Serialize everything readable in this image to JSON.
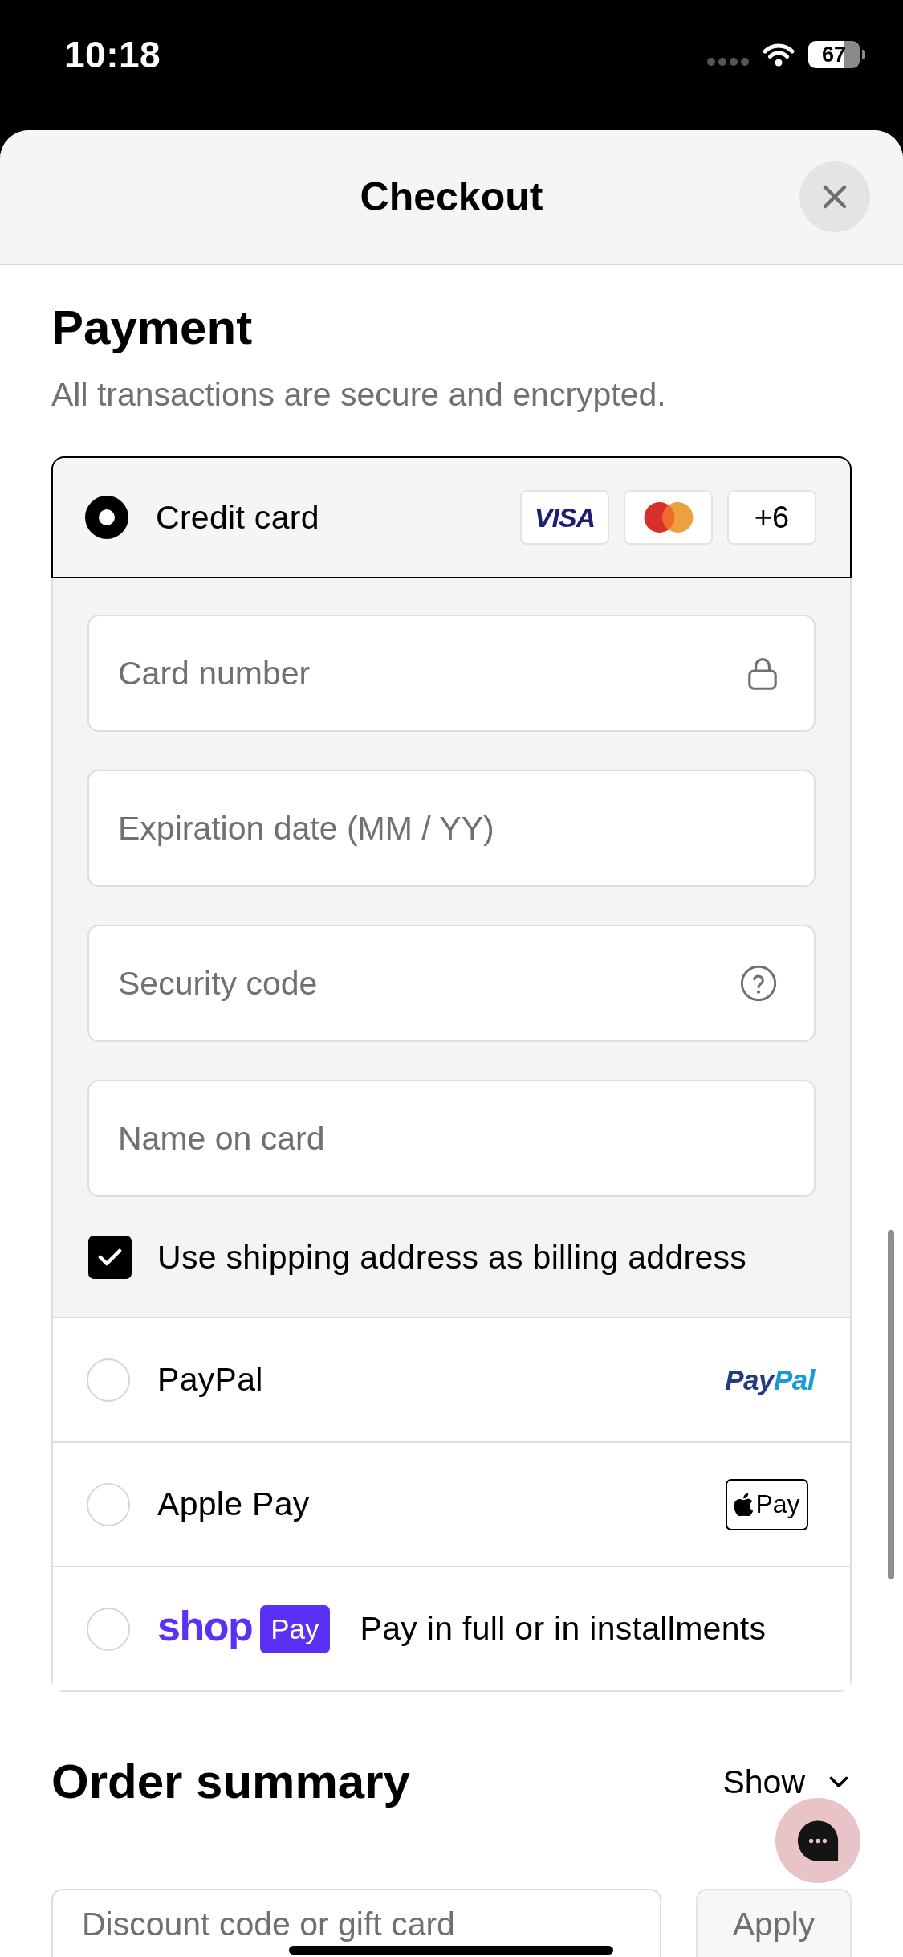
{
  "status_bar": {
    "time": "10:18",
    "battery": "67"
  },
  "sheet": {
    "title": "Checkout"
  },
  "payment": {
    "title": "Payment",
    "subtitle": "All transactions are secure and encrypted.",
    "methods": [
      {
        "kind": "card",
        "label": "Credit card",
        "selected": true,
        "logos": [
          {
            "kind": "visa",
            "text": "VISA"
          },
          {
            "kind": "mastercard"
          },
          {
            "kind": "more",
            "text": "+6"
          }
        ]
      },
      {
        "kind": "paypal",
        "label": "PayPal",
        "selected": false,
        "logo": [
          "Pay",
          "Pal"
        ]
      },
      {
        "kind": "apple_pay",
        "label": "Apple Pay",
        "selected": false,
        "logo": [
          "Pay"
        ]
      },
      {
        "kind": "shop_pay",
        "label": "Pay in full or in installments",
        "selected": false,
        "logo": [
          "shop",
          "Pay"
        ]
      }
    ],
    "card_form": {
      "fields": [
        {
          "kind": "card_number",
          "placeholder": "Card number"
        },
        {
          "kind": "expiry",
          "placeholder": "Expiration date (MM / YY)"
        },
        {
          "kind": "security_code",
          "placeholder": "Security code"
        },
        {
          "kind": "name",
          "placeholder": "Name on card"
        }
      ],
      "billing_same": {
        "label": "Use shipping address as billing address",
        "checked": true
      }
    }
  },
  "order_summary": {
    "title": "Order summary",
    "toggle": {
      "label": "Show",
      "expanded": false
    },
    "discount": {
      "placeholder": "Discount code or gift card"
    },
    "apply": {
      "label": "Apply",
      "disabled": true
    }
  }
}
